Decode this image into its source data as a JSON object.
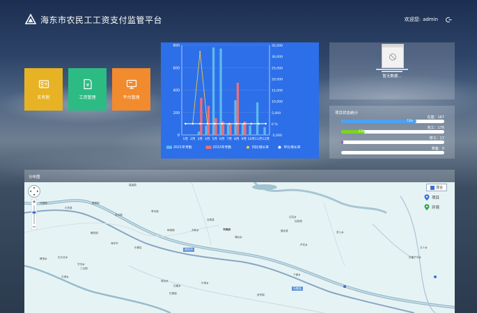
{
  "header": {
    "title": "海东市农民工工资支付监管平台",
    "welcome": "欢迎您:",
    "username": "admin"
  },
  "tiles": [
    {
      "label": "实名制",
      "color": "#e7b324",
      "icon": "id-card-icon"
    },
    {
      "label": "工资管理",
      "color": "#2dbb84",
      "icon": "wage-doc-icon"
    },
    {
      "label": "平台管理",
      "color": "#f28a2e",
      "icon": "monitor-icon"
    }
  ],
  "chart_data": {
    "type": "bar",
    "categories": [
      "1月",
      "2月",
      "3月",
      "4月",
      "5月",
      "6月",
      "7月",
      "8月",
      "9月",
      "10月",
      "11月",
      "12月"
    ],
    "y_left_ticks": [
      "0",
      "200",
      "400",
      "600",
      "800"
    ],
    "y_right_ticks": [
      "-5,000",
      "0 %",
      "5,000",
      "10,000",
      "15,000",
      "20,000",
      "25,000",
      "30,000",
      "35,000"
    ],
    "ylim_left": [
      0,
      800
    ],
    "ylim_right": [
      -5000,
      35000
    ],
    "series": [
      {
        "name": "2021年考勤",
        "kind": "bar",
        "color": "#5eb8ee",
        "values": [
          0,
          0,
          30,
          85,
          780,
          770,
          100,
          310,
          100,
          85,
          290,
          70
        ]
      },
      {
        "name": "2022年考勤",
        "kind": "bar",
        "color": "#ef6f74",
        "values": [
          0,
          0,
          330,
          260,
          150,
          120,
          100,
          465,
          120,
          0,
          0,
          0
        ]
      },
      {
        "name": "同比增长率",
        "kind": "line",
        "color": "#f0c84a",
        "values": [
          0,
          0,
          32000,
          0,
          0,
          0,
          0,
          0,
          0,
          0,
          0,
          0
        ]
      },
      {
        "name": "环比增长率",
        "kind": "line",
        "color": "#ffffff",
        "values": [
          0,
          0,
          0,
          0,
          0,
          0,
          0,
          0,
          0,
          0,
          0,
          0
        ]
      }
    ]
  },
  "nodata": {
    "text": "暂无数据..."
  },
  "status": {
    "title": "项目状态统计",
    "rows": [
      {
        "label": "在建：",
        "count": "167",
        "pct": "73%",
        "fraction": 0.73,
        "color": "#4ea1ef"
      },
      {
        "label": "完工：",
        "count": "176",
        "pct": "23%",
        "fraction": 0.23,
        "color": "#7ed321"
      },
      {
        "label": "停工：",
        "count": "17",
        "pct": "",
        "fraction": 0.02,
        "color": "#9b59d0"
      },
      {
        "label": "筹备：",
        "count": "0",
        "pct": "",
        "fraction": 0.0,
        "color": "#cccccc"
      }
    ]
  },
  "map": {
    "title": "分布图",
    "type_label": "混合",
    "legend": [
      {
        "label": "项目",
        "icon": "blue-pin-icon",
        "color": "#3a6fd8"
      },
      {
        "label": "环境",
        "icon": "green-pin-icon",
        "color": "#2da84a"
      }
    ],
    "town_tags": [
      "海东市",
      "乐都县"
    ],
    "place_labels": [
      "平安县",
      "海东市",
      "乐都区",
      "互助县",
      "化隆县",
      "循化县",
      "高庙镇",
      "瞿昙镇",
      "洪水镇",
      "寿乐镇",
      "马营镇",
      "碾伯镇",
      "雨润镇",
      "共和乡",
      "达拉乡",
      "芦花乡",
      "城台乡",
      "中坝乡",
      "李家乡",
      "峰堆乡",
      "甘沟乡",
      "古城乡",
      "白崖乡",
      "巴燕镇",
      "石大仓乡",
      "三合镇",
      "官亭镇",
      "杏儿乡",
      "加定镇",
      "蒲台乡",
      "下营乡",
      "红崖子沟乡",
      "五十乡"
    ]
  }
}
